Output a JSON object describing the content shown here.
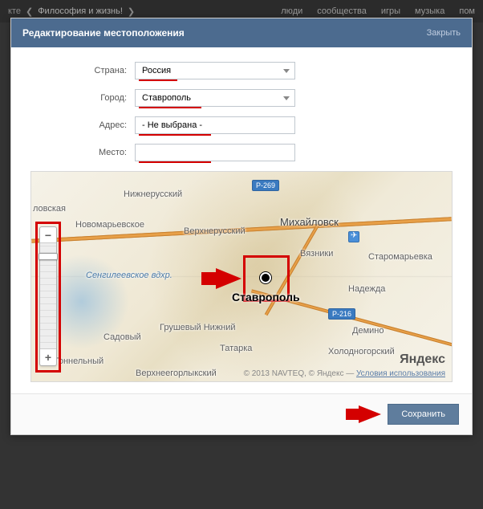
{
  "nav": {
    "logo_fragment": "кте",
    "chev_left": "❮",
    "breadcrumb": "Философия и жизнь!",
    "chev_right": "❯",
    "items": [
      "люди",
      "сообщества",
      "игры",
      "музыка",
      "пом"
    ]
  },
  "modal": {
    "title": "Редактирование местоположения",
    "close": "Закрыть"
  },
  "form": {
    "country_label": "Страна:",
    "country_value": "Россия",
    "city_label": "Город:",
    "city_value": "Ставрополь",
    "address_label": "Адрес:",
    "address_value": "- Не выбрана -",
    "place_label": "Место:",
    "place_value": ""
  },
  "map": {
    "labels": {
      "nizhnerussky": "Нижнерусский",
      "lovskaya": "ловская",
      "novomarevskoye": "Новомарьевское",
      "verkhnerussky": "Верхнерусский",
      "mikhailovsk": "Михайловск",
      "vyazniki": "Вязники",
      "staromarevka": "Старомарьевка",
      "sengileevskoe": "Сенгилеевское вдхр.",
      "nadezhda": "Надежда",
      "grushevy": "Грушевый Нижний",
      "sadovy": "Садовый",
      "tatarka": "Татарка",
      "demino": "Демино",
      "kholodnogorsky": "Холодногорский",
      "tonnelny": "Тоннельный",
      "verkhneyegorlystsky": "Верхнеегорлыкский",
      "marker": "Ставрополь"
    },
    "roads": {
      "r269": "Р-269",
      "r216": "Р-216"
    },
    "credit_prefix": "© 2013 NAVTEQ, © Яндекс — ",
    "credit_link": "Условия использования",
    "yandex": "Яндекс"
  },
  "footer": {
    "save": "Сохранить"
  },
  "glyphs": {
    "minus": "−",
    "plus": "+"
  }
}
